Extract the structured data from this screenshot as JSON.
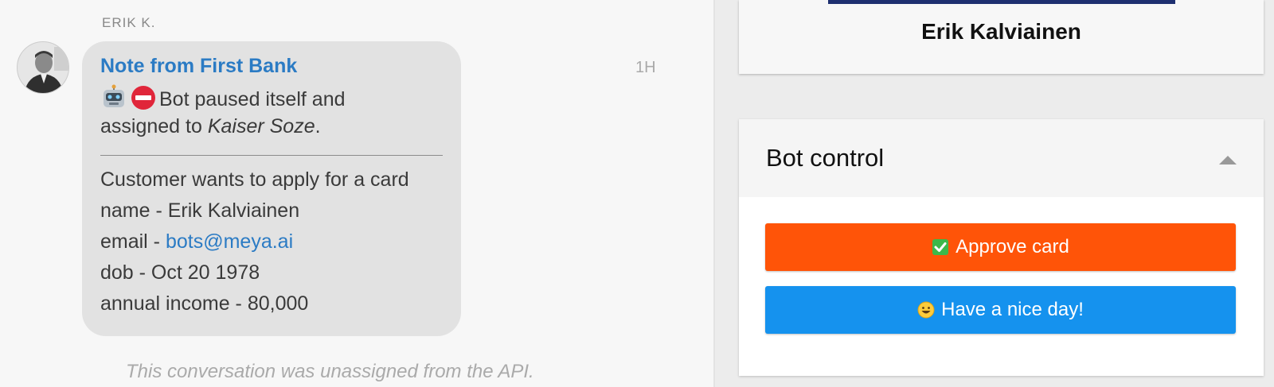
{
  "conversation": {
    "sender_name": "ERIK K.",
    "timestamp": "1H",
    "system_message": "This conversation was unassigned from the API.",
    "message": {
      "title": "Note from First Bank",
      "status_prefix": "Bot paused itself and",
      "status_assigned": "assigned to ",
      "assignee": "Kaiser Soze",
      "status_suffix": ".",
      "status_icons": [
        "robot-icon",
        "no-entry-icon"
      ],
      "details_intro": "Customer wants to apply for a card",
      "name_line": "name - Erik Kalviainen",
      "email_label": "email - ",
      "email_value": "bots@meya.ai",
      "dob_line": "dob - Oct 20 1978",
      "income_line": "annual income - 80,000"
    }
  },
  "profile": {
    "name": "Erik Kalviainen"
  },
  "bot_control": {
    "title": "Bot control",
    "buttons": [
      {
        "label": "Approve card",
        "icon": "check-mark-icon",
        "color": "#ff5408"
      },
      {
        "label": "Have a nice day!",
        "icon": "smiley-icon",
        "color": "#1592ee"
      }
    ]
  },
  "colors": {
    "link": "#2b7bc4",
    "bubble": "#e2e2e2",
    "approve": "#ff5408",
    "nice_day": "#1592ee"
  }
}
